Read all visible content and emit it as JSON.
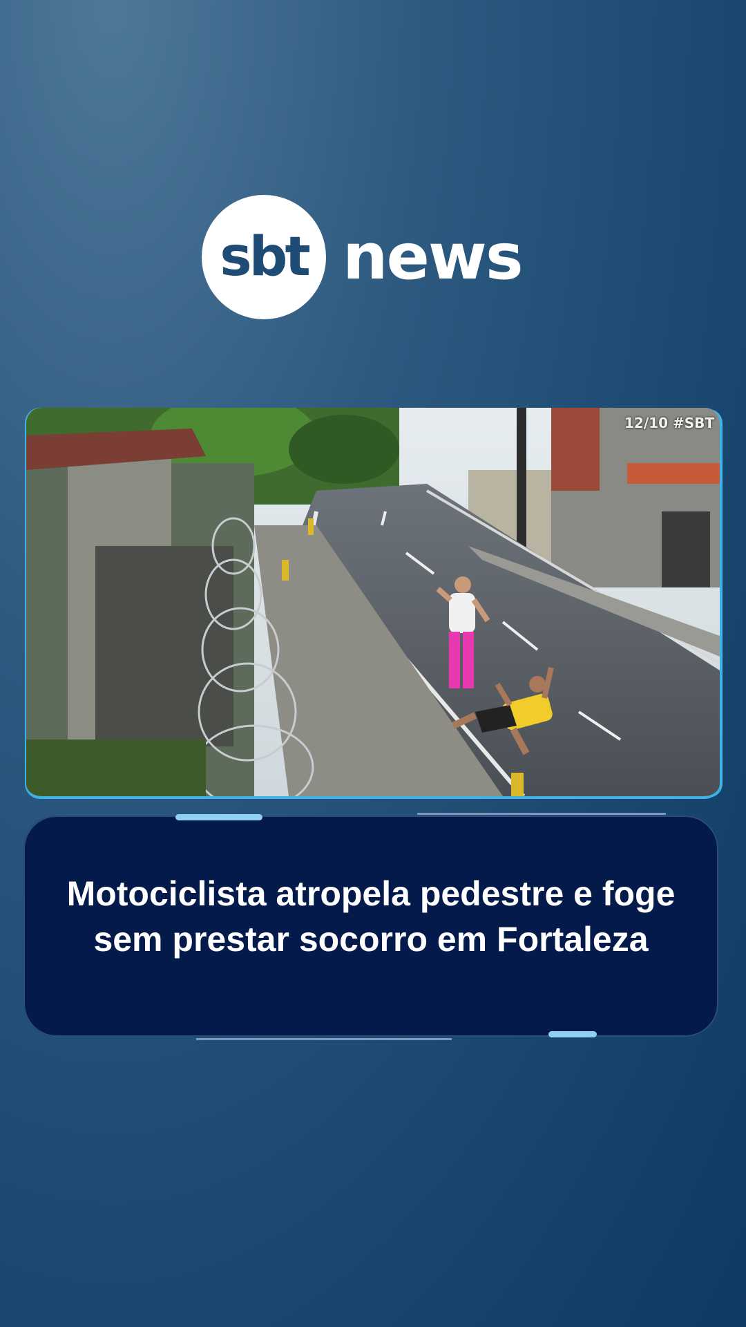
{
  "brand": {
    "logo_mark": "sbt",
    "logo_word": "news"
  },
  "video": {
    "timestamp": "12/10 #SBT",
    "description_icon": "video-thumbnail"
  },
  "headline": {
    "text": "Motociclista atropela pedestre e foge sem prestar socorro em Fortaleza"
  },
  "colors": {
    "background": "#1c4a72",
    "headline_box": "#041a4a",
    "accent": "#8fd0f3",
    "frame_border": "#3fb3e8"
  }
}
